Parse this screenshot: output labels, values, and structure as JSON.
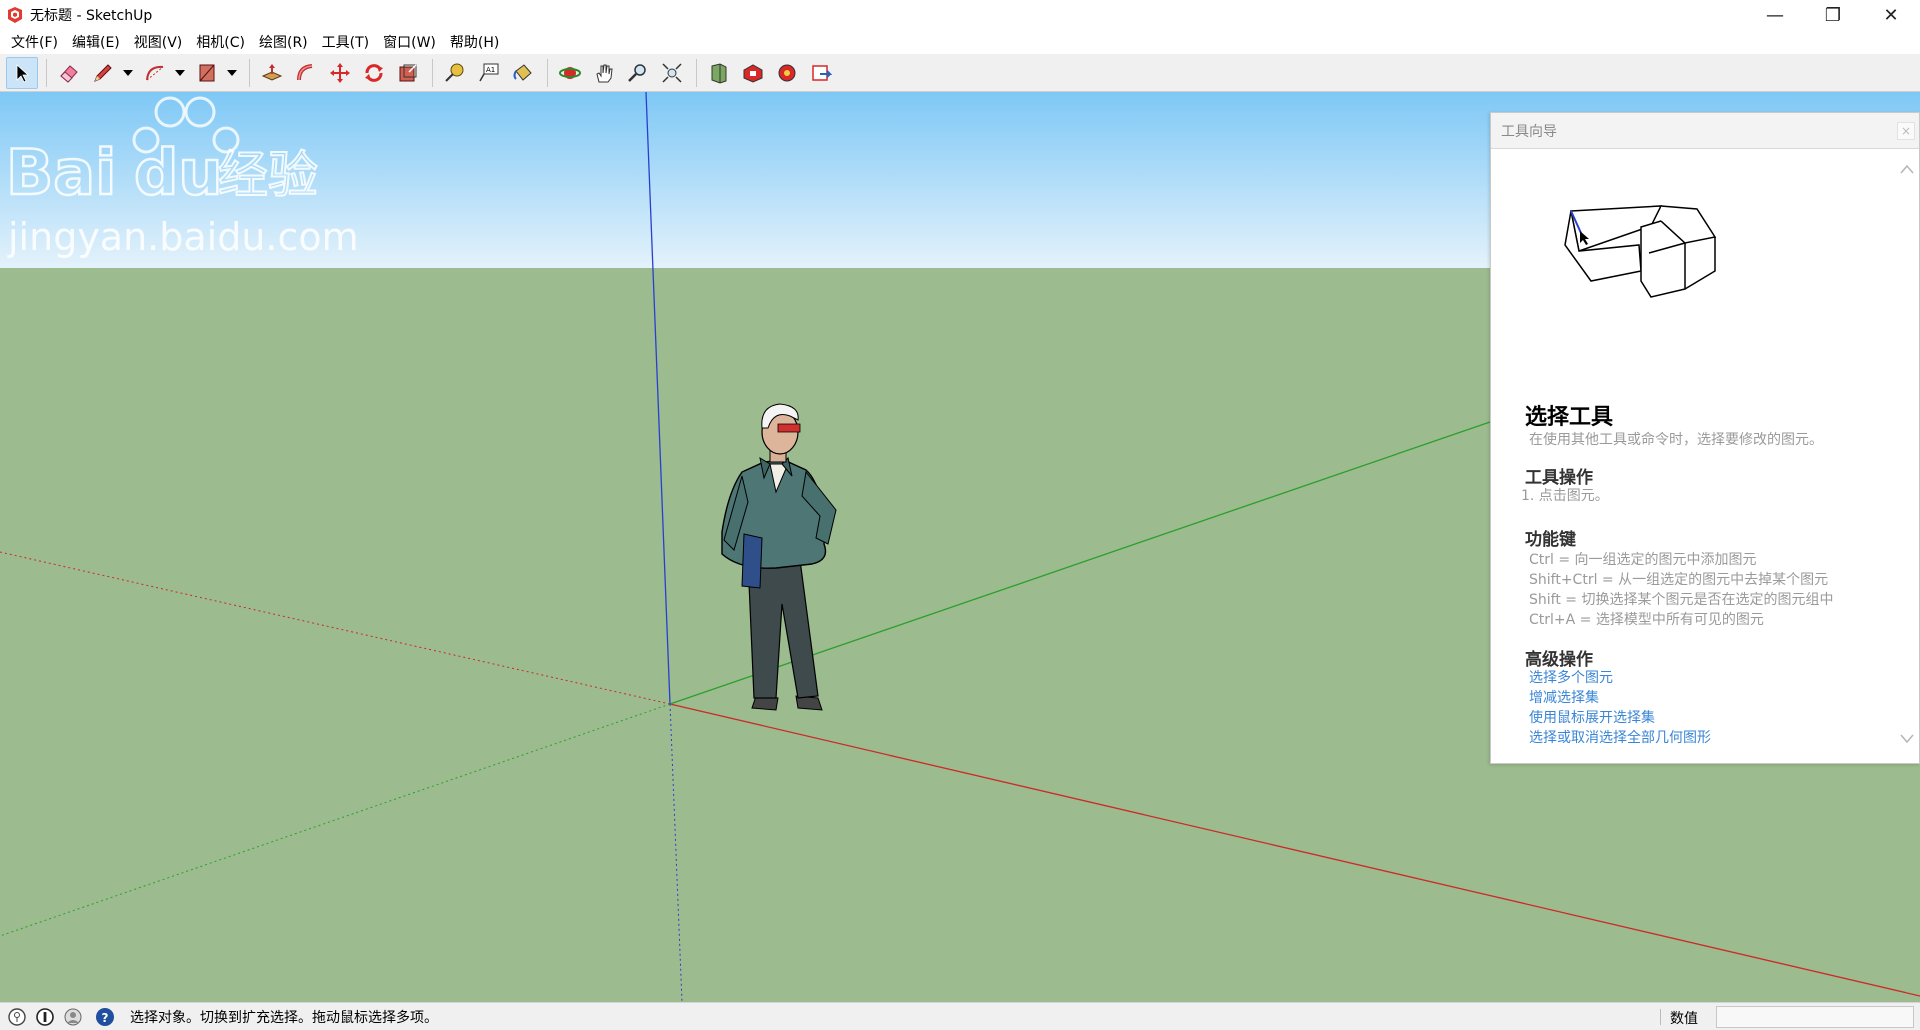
{
  "window": {
    "title": "无标题 - SketchUp",
    "minimize_glyph": "—",
    "maximize_glyph": "❐",
    "close_glyph": "✕"
  },
  "menu": {
    "items": [
      {
        "label": "文件(F)"
      },
      {
        "label": "编辑(E)"
      },
      {
        "label": "视图(V)"
      },
      {
        "label": "相机(C)"
      },
      {
        "label": "绘图(R)"
      },
      {
        "label": "工具(T)"
      },
      {
        "label": "窗口(W)"
      },
      {
        "label": "帮助(H)"
      }
    ]
  },
  "toolbar": {
    "tools": [
      {
        "icon": "select-arrow-icon",
        "active": true
      },
      {
        "icon": "eraser-icon"
      },
      {
        "icon": "pencil-line-icon"
      },
      {
        "icon": "arc-icon"
      },
      {
        "icon": "rectangle-icon"
      },
      {
        "icon": "push-pull-icon"
      },
      {
        "icon": "follow-me-icon"
      },
      {
        "icon": "move-icon"
      },
      {
        "icon": "rotate-icon"
      },
      {
        "icon": "scale-icon"
      },
      {
        "icon": "tape-measure-icon"
      },
      {
        "icon": "text-label-icon"
      },
      {
        "icon": "paint-bucket-icon"
      },
      {
        "icon": "orbit-icon"
      },
      {
        "icon": "pan-hand-icon"
      },
      {
        "icon": "zoom-icon"
      },
      {
        "icon": "zoom-extents-icon"
      },
      {
        "icon": "3d-warehouse-icon"
      },
      {
        "icon": "extension-warehouse-icon"
      },
      {
        "icon": "layout-send-icon"
      },
      {
        "icon": "extension-manager-icon"
      }
    ]
  },
  "colors": {
    "sky_top": "#7ec8f6",
    "sky_bottom": "#e4f2fb",
    "ground": "#9cbb8e",
    "axis_red": "#cc2a2a",
    "axis_green": "#2aa02a",
    "axis_blue": "#2a3fd0",
    "link": "#3a86d6"
  },
  "instructor": {
    "header_title": "工具向导",
    "close_glyph": "×",
    "tool_title": "选择工具",
    "tool_description": "在使用其他工具或命令时，选择要修改的图元。",
    "operations": {
      "heading": "工具操作",
      "steps": [
        "1.    点击图元。"
      ]
    },
    "modifier_keys": {
      "heading": "功能键",
      "lines": [
        "Ctrl = 向一组选定的图元中添加图元",
        "Shift+Ctrl = 从一组选定的图元中去掉某个图元",
        "Shift = 切换选择某个图元是否在选定的图元组中",
        "Ctrl+A = 选择模型中所有可见的图元"
      ]
    },
    "advanced": {
      "heading": "高级操作",
      "links": [
        "选择多个图元",
        "增减选择集",
        "使用鼠标展开选择集",
        "选择或取消选择全部几何图形"
      ]
    }
  },
  "watermark": {
    "brand": "Bai",
    "brand2": "du",
    "cn": "经验",
    "url": "jingyan.baidu.com"
  },
  "statusbar": {
    "message": "选择对象。切换到扩充选择。拖动鼠标选择多项。",
    "measure_label": "数值",
    "measure_value": ""
  }
}
